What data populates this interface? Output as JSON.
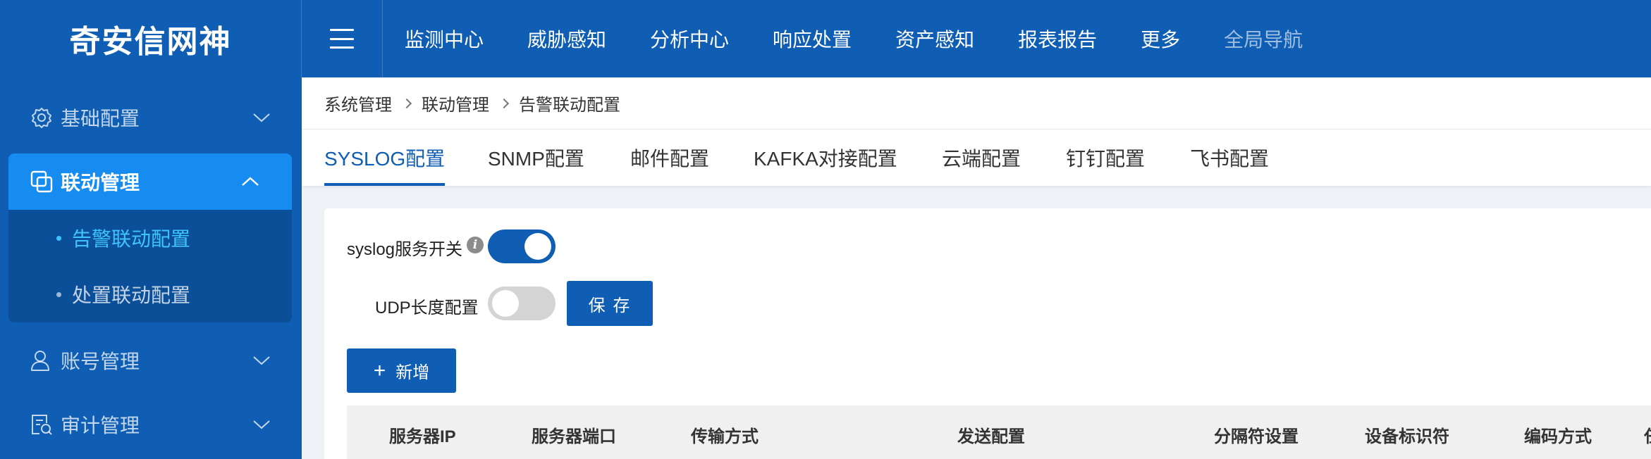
{
  "app": {
    "brand": "奇安信网神"
  },
  "topnav": {
    "items": [
      "监测中心",
      "威胁感知",
      "分析中心",
      "响应处置",
      "资产感知",
      "报表报告",
      "更多"
    ],
    "global_nav": "全局导航"
  },
  "sidebar": {
    "items": [
      {
        "label": "基础配置",
        "icon": "gear-icon",
        "expanded": false
      },
      {
        "label": "联动管理",
        "icon": "linkage-icon",
        "expanded": true,
        "children": [
          {
            "label": "告警联动配置",
            "active": true
          },
          {
            "label": "处置联动配置",
            "active": false
          }
        ]
      },
      {
        "label": "账号管理",
        "icon": "user-icon",
        "expanded": false
      },
      {
        "label": "审计管理",
        "icon": "audit-icon",
        "expanded": false
      }
    ]
  },
  "breadcrumb": [
    "系统管理",
    "联动管理",
    "告警联动配置"
  ],
  "tabs": [
    {
      "label": "SYSLOG配置",
      "active": true
    },
    {
      "label": "SNMP配置"
    },
    {
      "label": "邮件配置"
    },
    {
      "label": "KAFKA对接配置"
    },
    {
      "label": "云端配置"
    },
    {
      "label": "钉钉配置"
    },
    {
      "label": "飞书配置"
    }
  ],
  "form": {
    "syslog_label": "syslog服务开关",
    "syslog_enabled": true,
    "info_glyph": "i",
    "udp_label": "UDP长度配置",
    "udp_enabled": false,
    "save_label": "保 存",
    "add_label": "新增",
    "add_icon": "+"
  },
  "table": {
    "headers": [
      "服务器IP",
      "服务器端口",
      "传输方式",
      "发送配置",
      "分隔符设置",
      "设备标识符",
      "编码方式",
      "任"
    ]
  },
  "colors": {
    "primary": "#0f5eb4",
    "active_menu": "#168cf0",
    "active_sub": "#3ec3ff"
  }
}
